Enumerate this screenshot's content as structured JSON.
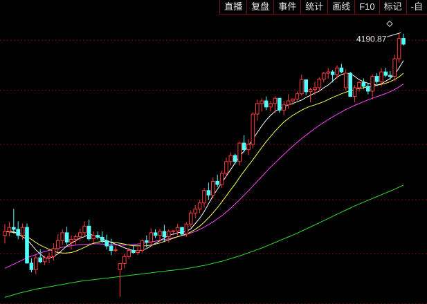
{
  "toolbar": {
    "items": [
      "直播",
      "复盘",
      "事件",
      "统计",
      "画线",
      "F10",
      "标记",
      "-自"
    ]
  },
  "chart_data": {
    "type": "candlestick",
    "ylim": [
      3170,
      4260
    ],
    "gridlines": [
      4165,
      3975,
      3770,
      3560,
      3355,
      3165
    ],
    "grid": "dashed-horizontal",
    "annotation": {
      "text": "4190.87",
      "value": 4190.87
    },
    "colors": {
      "up": "#ff3b3b",
      "down": "#54ffff",
      "grid": "#7a1010",
      "ma5": "#ffffff",
      "ma10": "#ffff55",
      "ma20": "#ff44ff",
      "ma60": "#33dd33"
    },
    "candles": [
      [
        3425,
        3468,
        3394,
        3440
      ],
      [
        3440,
        3476,
        3422,
        3455
      ],
      [
        3455,
        3525,
        3432,
        3448
      ],
      [
        3448,
        3478,
        3410,
        3425
      ],
      [
        3425,
        3470,
        3408,
        3455
      ],
      [
        3455,
        3470,
        3318,
        3320
      ],
      [
        3320,
        3338,
        3285,
        3295
      ],
      [
        3295,
        3350,
        3278,
        3340
      ],
      [
        3340,
        3372,
        3320,
        3325
      ],
      [
        3325,
        3348,
        3312,
        3340
      ],
      [
        3340,
        3360,
        3320,
        3345
      ],
      [
        3345,
        3395,
        3330,
        3375
      ],
      [
        3375,
        3430,
        3362,
        3405
      ],
      [
        3405,
        3448,
        3390,
        3435
      ],
      [
        3435,
        3458,
        3390,
        3400
      ],
      [
        3400,
        3425,
        3372,
        3410
      ],
      [
        3410,
        3428,
        3388,
        3420
      ],
      [
        3420,
        3450,
        3405,
        3435
      ],
      [
        3435,
        3478,
        3420,
        3460
      ],
      [
        3460,
        3485,
        3405,
        3412
      ],
      [
        3412,
        3440,
        3396,
        3425
      ],
      [
        3425,
        3440,
        3410,
        3418
      ],
      [
        3418,
        3440,
        3396,
        3405
      ],
      [
        3405,
        3428,
        3372,
        3385
      ],
      [
        3385,
        3412,
        3350,
        3368
      ],
      [
        3368,
        3385,
        3362,
        3370
      ],
      [
        3295,
        3320,
        3192,
        3318
      ],
      [
        3318,
        3355,
        3300,
        3345
      ],
      [
        3345,
        3380,
        3335,
        3368
      ],
      [
        3368,
        3388,
        3355,
        3360
      ],
      [
        3360,
        3380,
        3350,
        3368
      ],
      [
        3368,
        3410,
        3360,
        3405
      ],
      [
        3405,
        3425,
        3380,
        3400
      ],
      [
        3400,
        3452,
        3385,
        3435
      ],
      [
        3435,
        3448,
        3415,
        3425
      ],
      [
        3425,
        3450,
        3400,
        3440
      ],
      [
        3440,
        3465,
        3400,
        3420
      ],
      [
        3420,
        3448,
        3398,
        3440
      ],
      [
        3440,
        3445,
        3425,
        3442
      ],
      [
        3442,
        3468,
        3425,
        3455
      ],
      [
        3455,
        3450,
        3425,
        3430
      ],
      [
        3430,
        3475,
        3420,
        3468
      ],
      [
        3468,
        3520,
        3455,
        3510
      ],
      [
        3510,
        3540,
        3490,
        3525
      ],
      [
        3525,
        3560,
        3510,
        3548
      ],
      [
        3548,
        3605,
        3530,
        3595
      ],
      [
        3595,
        3625,
        3560,
        3578
      ],
      [
        3578,
        3645,
        3565,
        3630
      ],
      [
        3630,
        3655,
        3608,
        3618
      ],
      [
        3618,
        3670,
        3605,
        3660
      ],
      [
        3660,
        3720,
        3650,
        3705
      ],
      [
        3705,
        3740,
        3690,
        3728
      ],
      [
        3728,
        3735,
        3695,
        3705
      ],
      [
        3705,
        3780,
        3690,
        3775
      ],
      [
        3775,
        3805,
        3740,
        3750
      ],
      [
        3750,
        3790,
        3730,
        3770
      ],
      [
        3770,
        3892,
        3755,
        3885
      ],
      [
        3885,
        3940,
        3860,
        3925
      ],
      [
        3925,
        3945,
        3895,
        3935
      ],
      [
        3935,
        3952,
        3900,
        3912
      ],
      [
        3912,
        3935,
        3895,
        3925
      ],
      [
        3925,
        3952,
        3890,
        3945
      ],
      [
        3945,
        3945,
        3890,
        3900
      ],
      [
        3900,
        3935,
        3880,
        3920
      ],
      [
        3920,
        3960,
        3905,
        3935
      ],
      [
        3935,
        3945,
        3920,
        3942
      ],
      [
        3942,
        3970,
        3935,
        3962
      ],
      [
        3962,
        4035,
        3955,
        4015
      ],
      [
        4015,
        4005,
        3958,
        3970
      ],
      [
        3970,
        3985,
        3930,
        3978
      ],
      [
        3978,
        4008,
        3958,
        3985
      ],
      [
        3985,
        4025,
        3970,
        4018
      ],
      [
        4018,
        4045,
        4005,
        4040
      ],
      [
        4040,
        4060,
        4020,
        4045
      ],
      [
        4045,
        4052,
        4005,
        4035
      ],
      [
        4035,
        4070,
        4020,
        4060
      ],
      [
        4060,
        4075,
        4040,
        4045
      ],
      [
        3985,
        4055,
        3975,
        4040
      ],
      [
        4040,
        4045,
        3950,
        3952
      ],
      [
        3952,
        3995,
        3930,
        3985
      ],
      [
        3985,
        4010,
        3970,
        4005
      ],
      [
        4005,
        4020,
        3980,
        3990
      ],
      [
        3990,
        4000,
        3960,
        3972
      ],
      [
        3972,
        4035,
        3940,
        4028
      ],
      [
        4028,
        4040,
        4000,
        4008
      ],
      [
        4008,
        4060,
        3990,
        4045
      ],
      [
        4045,
        4060,
        4025,
        4032
      ],
      [
        4032,
        4048,
        4015,
        4028
      ],
      [
        4028,
        4110,
        4010,
        4095
      ],
      [
        4095,
        4190,
        4080,
        4172
      ],
      [
        4172,
        4190,
        4145,
        4150
      ]
    ],
    "ma": {
      "ma5": [
        3440,
        3440,
        3440,
        3430,
        3420,
        3410,
        3390,
        3370,
        3355,
        3340,
        3338,
        3345,
        3355,
        3370,
        3385,
        3395,
        3405,
        3415,
        3420,
        3430,
        3425,
        3420,
        3412,
        3405,
        3398,
        3392,
        3385,
        3378,
        3372,
        3368,
        3365,
        3370,
        3375,
        3385,
        3395,
        3405,
        3415,
        3425,
        3430,
        3435,
        3438,
        3440,
        3450,
        3470,
        3490,
        3515,
        3545,
        3575,
        3600,
        3625,
        3650,
        3675,
        3700,
        3725,
        3745,
        3765,
        3790,
        3815,
        3840,
        3862,
        3880,
        3895,
        3905,
        3912,
        3920,
        3925,
        3932,
        3938,
        3948,
        3956,
        3965,
        3972,
        3985,
        3995,
        4010,
        4025,
        4035,
        4040,
        4038,
        4028,
        4015,
        4008,
        4002,
        3998,
        3995,
        4000,
        4010,
        4020,
        4035,
        4060,
        4088
      ],
      "ma10": [
        3440,
        3438,
        3436,
        3432,
        3428,
        3420,
        3410,
        3398,
        3388,
        3380,
        3372,
        3365,
        3360,
        3358,
        3358,
        3360,
        3365,
        3372,
        3380,
        3388,
        3395,
        3400,
        3402,
        3402,
        3400,
        3398,
        3395,
        3392,
        3388,
        3386,
        3385,
        3385,
        3386,
        3388,
        3392,
        3396,
        3402,
        3408,
        3414,
        3420,
        3425,
        3430,
        3438,
        3448,
        3460,
        3475,
        3492,
        3510,
        3530,
        3552,
        3575,
        3598,
        3620,
        3645,
        3668,
        3690,
        3712,
        3735,
        3758,
        3780,
        3800,
        3820,
        3838,
        3855,
        3868,
        3880,
        3890,
        3900,
        3908,
        3915,
        3920,
        3926,
        3932,
        3940,
        3948,
        3955,
        3962,
        3968,
        3974,
        3978,
        3982,
        3985,
        3988,
        3990,
        3994,
        3998,
        4002,
        4008,
        4016,
        4026,
        4040
      ],
      "ma20": [
        3300,
        3308,
        3316,
        3324,
        3332,
        3340,
        3346,
        3352,
        3358,
        3364,
        3368,
        3372,
        3376,
        3380,
        3383,
        3386,
        3388,
        3390,
        3391,
        3392,
        3393,
        3393,
        3392,
        3391,
        3390,
        3389,
        3388,
        3388,
        3389,
        3390,
        3392,
        3394,
        3397,
        3400,
        3403,
        3406,
        3409,
        3412,
        3416,
        3420,
        3424,
        3428,
        3434,
        3440,
        3448,
        3456,
        3466,
        3476,
        3488,
        3500,
        3514,
        3528,
        3544,
        3560,
        3577,
        3594,
        3612,
        3630,
        3648,
        3666,
        3684,
        3700,
        3716,
        3732,
        3748,
        3763,
        3778,
        3792,
        3805,
        3818,
        3830,
        3842,
        3853,
        3864,
        3874,
        3884,
        3893,
        3902,
        3910,
        3918,
        3925,
        3932,
        3939,
        3945,
        3951,
        3957,
        3963,
        3970,
        3978,
        3988,
        3999
      ],
      "ma60": [
        3190,
        3195,
        3200,
        3205,
        3209,
        3213,
        3217,
        3221,
        3224,
        3227,
        3230,
        3233,
        3236,
        3239,
        3242,
        3245,
        3248,
        3251,
        3253,
        3255,
        3257,
        3259,
        3261,
        3263,
        3265,
        3267,
        3269,
        3271,
        3273,
        3275,
        3277,
        3279,
        3281,
        3283,
        3285,
        3287,
        3289,
        3291,
        3293,
        3295,
        3297,
        3299,
        3302,
        3305,
        3308,
        3311,
        3315,
        3319,
        3323,
        3327,
        3332,
        3337,
        3342,
        3347,
        3353,
        3359,
        3365,
        3371,
        3377,
        3384,
        3391,
        3398,
        3405,
        3412,
        3419,
        3426,
        3433,
        3441,
        3449,
        3457,
        3465,
        3473,
        3481,
        3489,
        3497,
        3505,
        3513,
        3521,
        3529,
        3537,
        3544,
        3551,
        3558,
        3565,
        3572,
        3579,
        3586,
        3593,
        3600,
        3608,
        3616
      ]
    }
  }
}
